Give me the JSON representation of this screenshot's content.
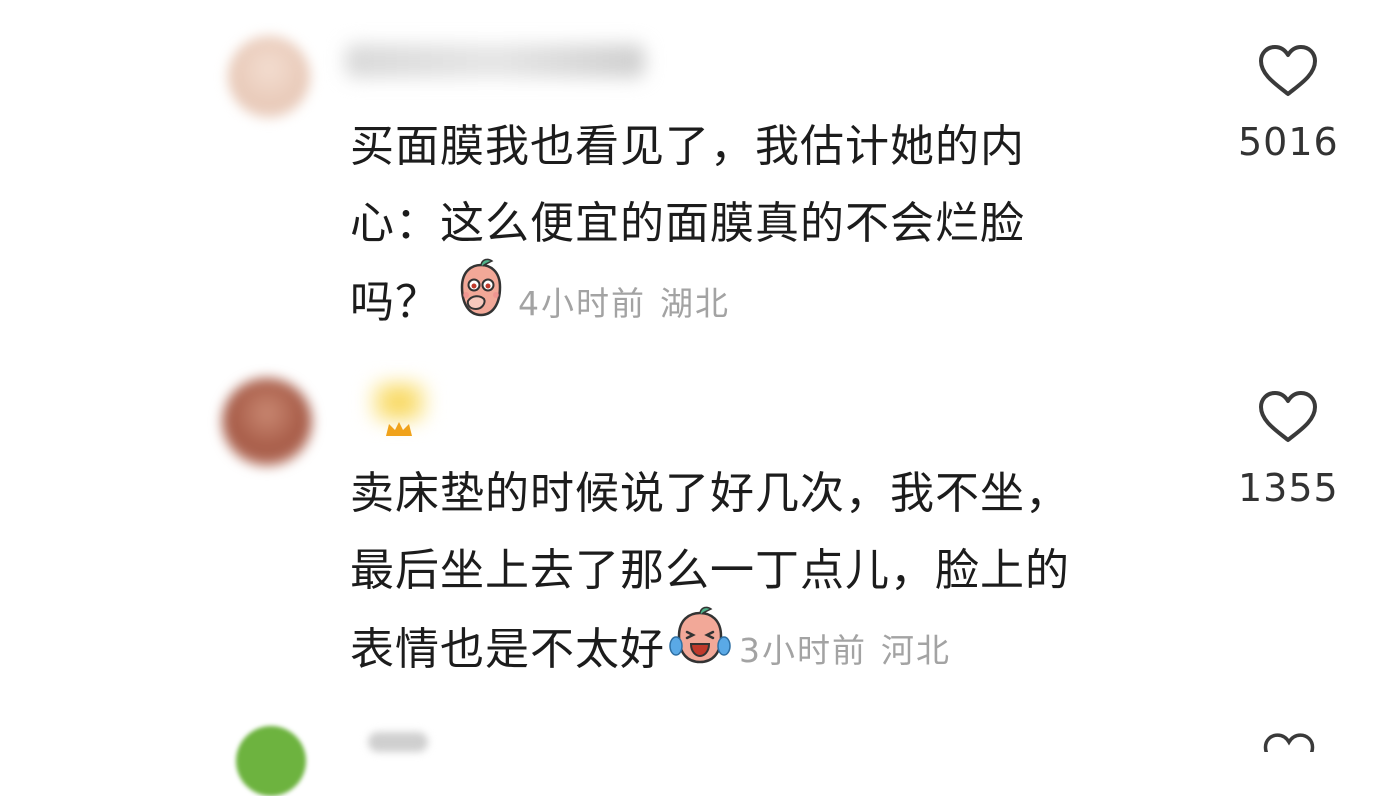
{
  "comments": [
    {
      "lines": [
        "买面膜我也看见了，我估计她的内",
        "心：这么便宜的面膜真的不会烂脸",
        "吗？"
      ],
      "time": "4小时前",
      "region": "湖北",
      "likes": "5016",
      "emoji_icon": "covering-mouth-emoji-icon"
    },
    {
      "lines": [
        "卖床垫的时候说了好几次，我不坐，",
        "最后坐上去了那么一丁点儿，脸上的",
        "表情也是不太好"
      ],
      "time": "3小时前",
      "region": "河北",
      "likes": "1355",
      "emoji_icon": "laughing-crying-emoji-icon"
    }
  ],
  "colors": {
    "text": "#1c1c1c",
    "meta": "#a3a3a3",
    "like_icon": "#3a3a3a"
  }
}
